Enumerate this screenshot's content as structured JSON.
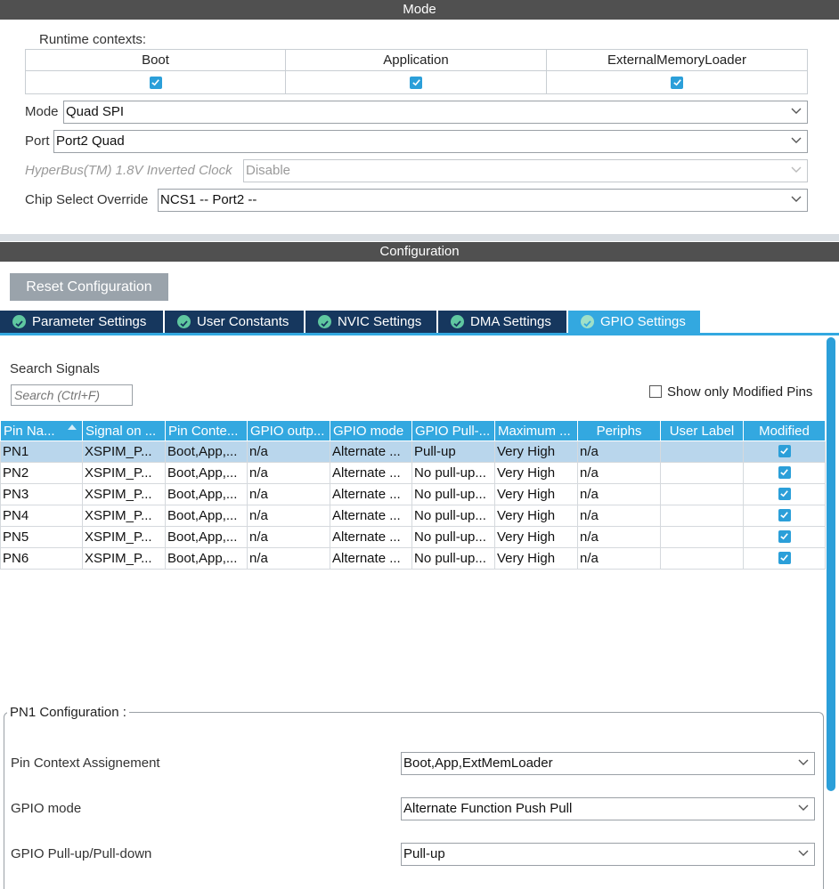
{
  "mode_section": {
    "title": "Mode",
    "runtime_contexts_label": "Runtime contexts:",
    "contexts": [
      {
        "label": "Boot",
        "checked": true
      },
      {
        "label": "Application",
        "checked": true
      },
      {
        "label": "ExternalMemoryLoader",
        "checked": true
      }
    ],
    "mode": {
      "label": "Mode",
      "value": "Quad SPI"
    },
    "port": {
      "label": "Port",
      "value": "Port2 Quad"
    },
    "hyperbus": {
      "label": "HyperBus(TM) 1.8V Inverted Clock",
      "value": "Disable",
      "disabled": true
    },
    "chip_select": {
      "label": "Chip Select Override",
      "value": "NCS1 -- Port2 --"
    }
  },
  "config_section": {
    "title": "Configuration",
    "reset_button": "Reset Configuration",
    "tabs": [
      {
        "label": "Parameter Settings",
        "active": false
      },
      {
        "label": "User Constants",
        "active": false
      },
      {
        "label": "NVIC Settings",
        "active": false
      },
      {
        "label": "DMA Settings",
        "active": false
      },
      {
        "label": "GPIO Settings",
        "active": true
      }
    ]
  },
  "gpio": {
    "search_title": "Search Signals",
    "search_placeholder": "Search (Ctrl+F)",
    "show_modified_label": "Show only Modified Pins",
    "show_modified_checked": false,
    "columns": [
      "Pin Na...",
      "Signal on ...",
      "Pin Conte...",
      "GPIO outp...",
      "GPIO mode",
      "GPIO Pull-...",
      "Maximum ...",
      "Periphs",
      "User Label",
      "Modified"
    ],
    "rows": [
      {
        "pin": "PN1",
        "signal": "XSPIM_P...",
        "context": "Boot,App,...",
        "output": "n/a",
        "mode": "Alternate ...",
        "pull": "Pull-up",
        "speed": "Very High",
        "periphs": "n/a",
        "label": "",
        "modified": true,
        "selected": true
      },
      {
        "pin": "PN2",
        "signal": "XSPIM_P...",
        "context": "Boot,App,...",
        "output": "n/a",
        "mode": "Alternate ...",
        "pull": "No pull-up...",
        "speed": "Very High",
        "periphs": "n/a",
        "label": "",
        "modified": true,
        "selected": false
      },
      {
        "pin": "PN3",
        "signal": "XSPIM_P...",
        "context": "Boot,App,...",
        "output": "n/a",
        "mode": "Alternate ...",
        "pull": "No pull-up...",
        "speed": "Very High",
        "periphs": "n/a",
        "label": "",
        "modified": true,
        "selected": false
      },
      {
        "pin": "PN4",
        "signal": "XSPIM_P...",
        "context": "Boot,App,...",
        "output": "n/a",
        "mode": "Alternate ...",
        "pull": "No pull-up...",
        "speed": "Very High",
        "periphs": "n/a",
        "label": "",
        "modified": true,
        "selected": false
      },
      {
        "pin": "PN5",
        "signal": "XSPIM_P...",
        "context": "Boot,App,...",
        "output": "n/a",
        "mode": "Alternate ...",
        "pull": "No pull-up...",
        "speed": "Very High",
        "periphs": "n/a",
        "label": "",
        "modified": true,
        "selected": false
      },
      {
        "pin": "PN6",
        "signal": "XSPIM_P...",
        "context": "Boot,App,...",
        "output": "n/a",
        "mode": "Alternate ...",
        "pull": "No pull-up...",
        "speed": "Very High",
        "periphs": "n/a",
        "label": "",
        "modified": true,
        "selected": false
      }
    ],
    "pin_config": {
      "title": "PN1 Configuration :",
      "fields": [
        {
          "label": "Pin Context Assignement",
          "value": "Boot,App,ExtMemLoader"
        },
        {
          "label": "GPIO mode",
          "value": "Alternate Function Push Pull"
        },
        {
          "label": "GPIO Pull-up/Pull-down",
          "value": "Pull-up"
        }
      ]
    }
  },
  "colors": {
    "header_bg": "#505050",
    "tab_bg": "#16375e",
    "accent": "#33a8e0",
    "selected_row": "#b9d6ec",
    "reset_btn": "#9aa3ab"
  }
}
